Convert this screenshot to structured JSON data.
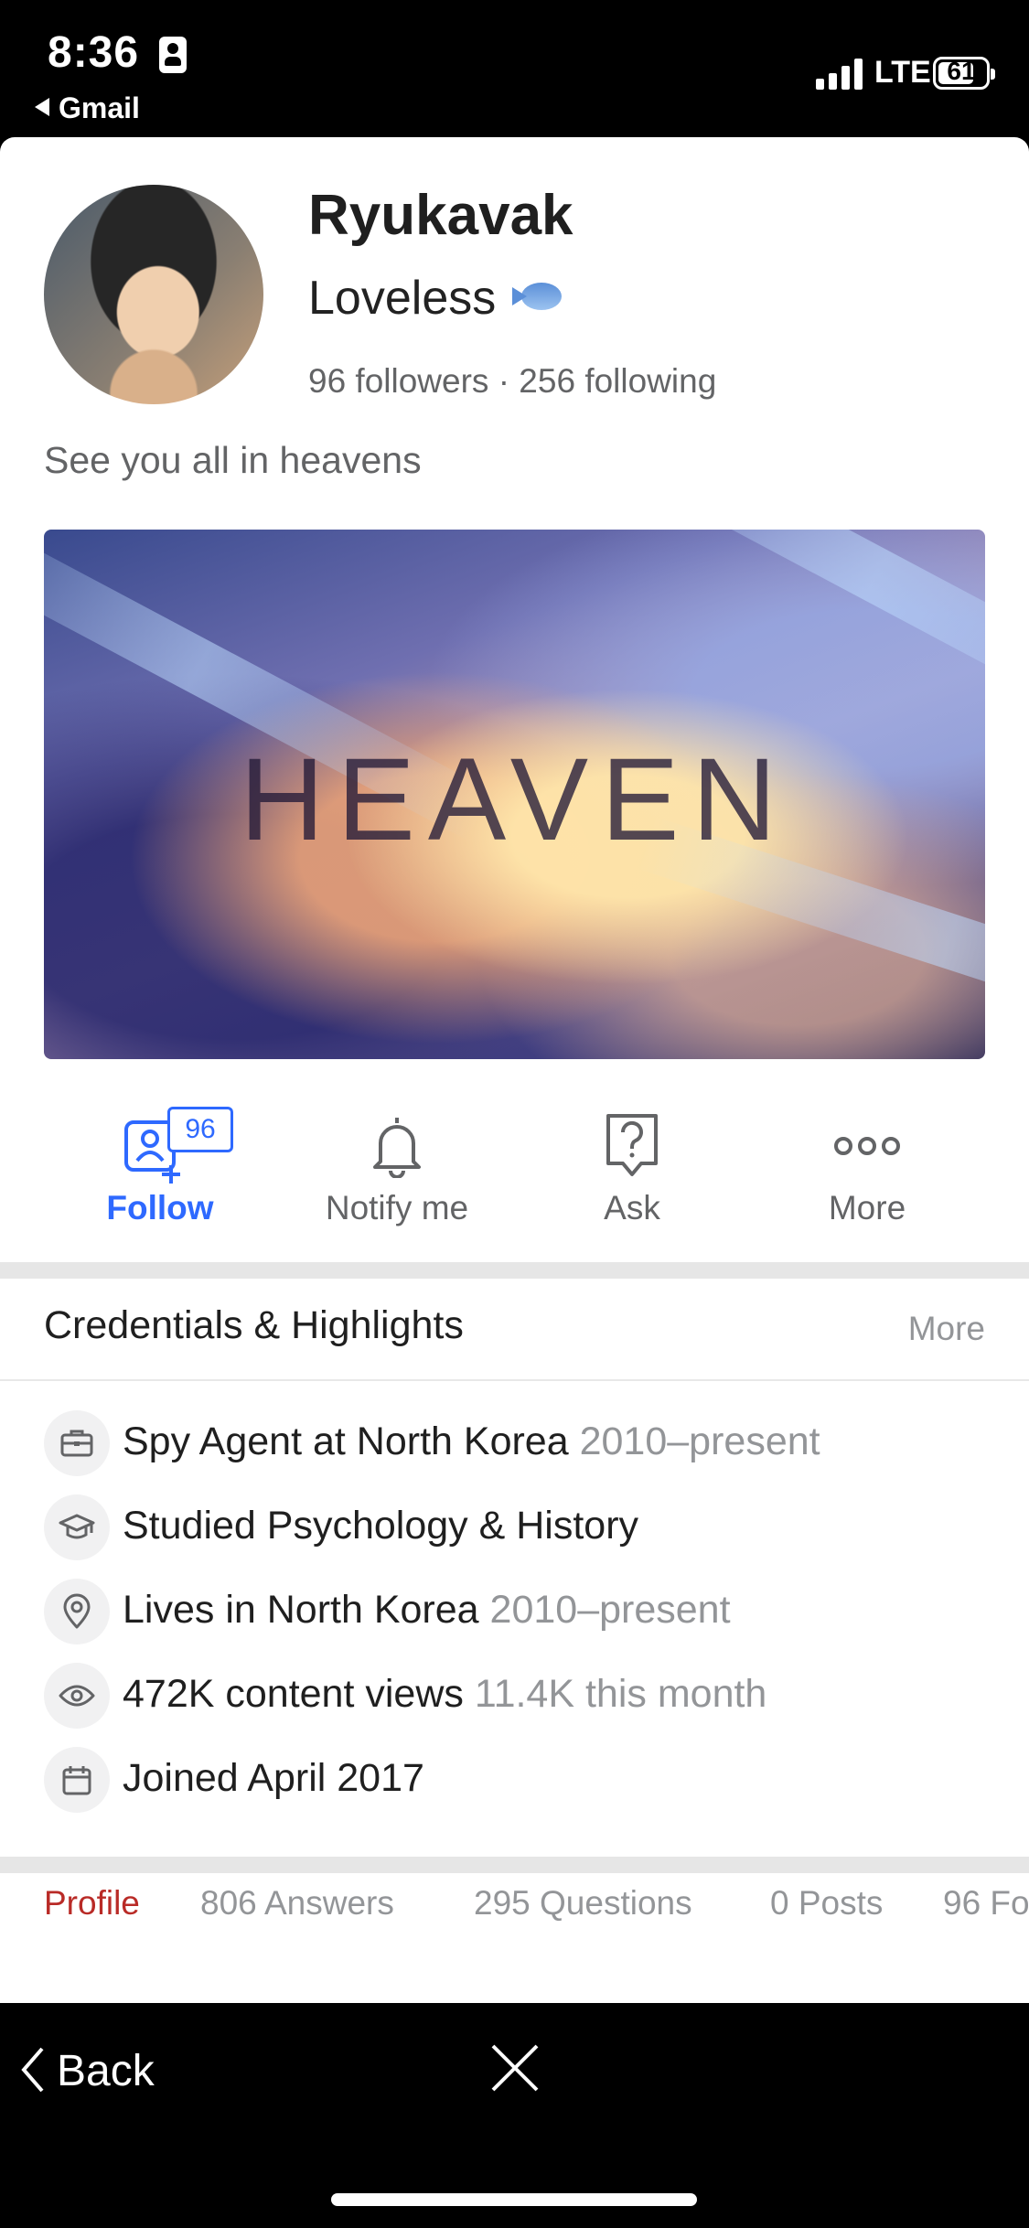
{
  "status_bar": {
    "time": "8:36",
    "back_app": "Gmail",
    "network": "LTE",
    "battery": "61"
  },
  "profile": {
    "name": "Ryukavak",
    "tagline": "Loveless",
    "tagline_emoji": "fish-emoji",
    "followers": "96 followers · 256 following",
    "bio": "See you all in heavens",
    "banner_text": "HEAVEN"
  },
  "actions": {
    "follow": "Follow",
    "follow_count": "96",
    "notify": "Notify me",
    "ask": "Ask",
    "more": "More"
  },
  "credentials": {
    "title": "Credentials & Highlights",
    "more": "More",
    "items": [
      {
        "icon": "briefcase-icon",
        "main": "Spy Agent at North Korea",
        "sub": "2010–present"
      },
      {
        "icon": "graduation-cap-icon",
        "main": "Studied Psychology & History",
        "sub": ""
      },
      {
        "icon": "location-pin-icon",
        "main": "Lives in North Korea",
        "sub": "2010–present"
      },
      {
        "icon": "eye-icon",
        "main": "472K content views",
        "sub": "11.4K this month"
      },
      {
        "icon": "calendar-icon",
        "main": "Joined April 2017",
        "sub": ""
      }
    ]
  },
  "tabs": [
    "Profile",
    "806 Answers",
    "295 Questions",
    "0 Posts",
    "96 Fo"
  ],
  "bottom_nav": {
    "back": "Back"
  },
  "colors": {
    "accent": "#2e69ff",
    "active_tab": "#b92b27",
    "muted": "#939598"
  }
}
